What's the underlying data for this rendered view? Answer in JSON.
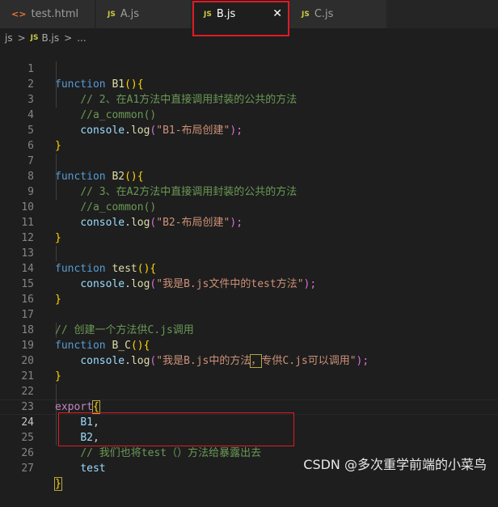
{
  "tabs": [
    {
      "icon": "<>",
      "label": "test.html"
    },
    {
      "icon": "JS",
      "label": "A.js"
    },
    {
      "icon": "JS",
      "label": "B.js",
      "close": "✕"
    },
    {
      "icon": "JS",
      "label": "C.js"
    }
  ],
  "breadcrumb": {
    "folder": "js",
    "sep1": ">",
    "icon": "JS",
    "file": "B.js",
    "sep2": ">",
    "more": "..."
  },
  "line_numbers": [
    "1",
    "2",
    "3",
    "4",
    "5",
    "6",
    "7",
    "8",
    "9",
    "10",
    "11",
    "12",
    "13",
    "14",
    "15",
    "16",
    "17",
    "18",
    "19",
    "20",
    "21",
    "22",
    "23",
    "24",
    "25",
    "26",
    "27"
  ],
  "code": {
    "l1": {
      "kw": "function",
      "name": "B1",
      "paren": "()",
      "brace": "{"
    },
    "l2": "// 2、在A1方法中直接调用封装的公共的方法",
    "l3": "//a_common()",
    "l4": {
      "obj": "console",
      "dot": ".",
      "fn": "log",
      "open": "(",
      "str": "\"B1-布局创建\"",
      "close": ");"
    },
    "l5": "}",
    "l7": {
      "kw": "function",
      "name": "B2",
      "paren": "()",
      "brace": "{"
    },
    "l8": "// 3、在A2方法中直接调用封装的公共的方法",
    "l9": "//a_common()",
    "l10": {
      "obj": "console",
      "dot": ".",
      "fn": "log",
      "open": "(",
      "str": "\"B2-布局创建\"",
      "close": ");"
    },
    "l11": "}",
    "l13": {
      "kw": "function",
      "name": "test",
      "paren": "()",
      "brace": "{"
    },
    "l14": {
      "obj": "console",
      "dot": ".",
      "fn": "log",
      "open": "(",
      "str": "\"我是B.js文件中的test方法\"",
      "close": ");"
    },
    "l15": "}",
    "l17": "// 创建一个方法供C.js调用",
    "l18": {
      "kw": "function",
      "name": "B_C",
      "paren": "()",
      "brace": "{"
    },
    "l19": {
      "obj": "console",
      "dot": ".",
      "fn": "log",
      "open": "(",
      "str_a": "\"我是B.js中的方法",
      "str_mark": "，",
      "str_b": "专供C.js可以调用\"",
      "close": ");"
    },
    "l20": "}",
    "l22": {
      "kw": "export",
      "brace": "{"
    },
    "l23": {
      "name": "B1",
      "punct": ","
    },
    "l24": {
      "name": "B2",
      "punct": ","
    },
    "l25": "// 我们也将test（）方法给暴露出去",
    "l26": "test",
    "l27": "}"
  },
  "watermark": "CSDN @多次重学前端的小菜鸟"
}
